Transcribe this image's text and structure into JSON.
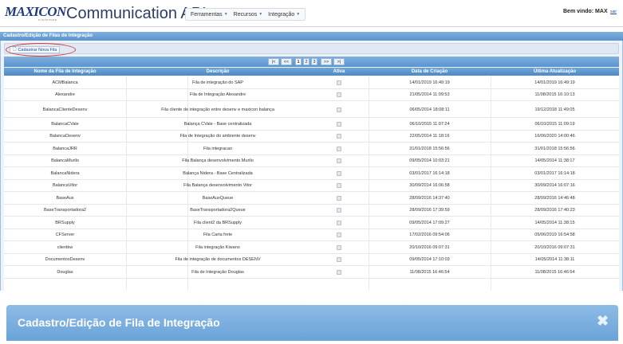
{
  "header": {
    "logo": "MAXICON",
    "logo_sub": "sistemas",
    "app_title": "Communication API",
    "menu": [
      {
        "label": "Ferramentas"
      },
      {
        "label": "Recursos"
      },
      {
        "label": "Integração"
      }
    ],
    "welcome": "Bem vindo: MAX",
    "logout": "sair"
  },
  "window": {
    "title": "Cadastro/Edição de Filas de Integração",
    "add_button": "Cadastrar Nova Fila",
    "pager": {
      "first": "|<",
      "prev": "<<",
      "pages": [
        "1",
        "2",
        "3"
      ],
      "next": ">>",
      "last": ">|",
      "current": "1"
    },
    "columns": [
      "Nome da Fila de Integração",
      "Descrição",
      "Ativa",
      "Data de Criação",
      "Última Atualização"
    ],
    "rows": [
      {
        "name": "ACMBalanca",
        "desc": "Fila de integração do SAP",
        "created": "14/01/2019 16:49:19",
        "updated": "14/01/2019 16:49:19"
      },
      {
        "name": "Alexandre",
        "desc": "Fila de Integração Alexandre",
        "created": "21/05/2014 11:09:53",
        "updated": "11/08/2015 16:10:13"
      },
      {
        "name": "BalancaClienteDesenv",
        "desc": "Fila cliente de integração entre desenv e maxicon balança",
        "created": "06/05/2014 18:08:11",
        "updated": "19/12/2018 11:49:05"
      },
      {
        "name": "BalancaCVale",
        "desc": "Balança CVale - Base centralizada",
        "created": "06/10/2015 11:07:24",
        "updated": "06/10/2015 11:09:19"
      },
      {
        "name": "BalancaDesenv",
        "desc": "Fila de Integração do ambiente desenv",
        "created": "22/05/2014 11:18:16",
        "updated": "16/06/2020 14:00:46"
      },
      {
        "name": "BalancaJRR",
        "desc": "Fila integracao",
        "created": "31/01/2018 15:56:56",
        "updated": "31/01/2018 15:56:56"
      },
      {
        "name": "BalancaMurilo",
        "desc": "Fila Balança desenvolvimento Murilo",
        "created": "09/05/2014 10:03:21",
        "updated": "14/05/2014 11:38:17"
      },
      {
        "name": "BalancaNidera",
        "desc": "Balança Nidera - Base Centralizada",
        "created": "03/01/2017 16:14:18",
        "updated": "03/01/2017 16:14:18"
      },
      {
        "name": "BalancaVitor",
        "desc": "Fila Balança desenvolvimento Vitor",
        "created": "30/09/2014 16:06:58",
        "updated": "30/09/2014 16:07:16"
      },
      {
        "name": "BaseAux",
        "desc": "BaseAuxQueue",
        "created": "28/09/2016 14:37:40",
        "updated": "28/09/2016 14:46:48"
      },
      {
        "name": "BaseTransportadora2",
        "desc": "BaseTransportadora2Queue",
        "created": "28/09/2016 17:39:59",
        "updated": "28/09/2016 17:40:23"
      },
      {
        "name": "BRSupply",
        "desc": "Fila client2 da BRSupply",
        "created": "09/05/2014 17:09:27",
        "updated": "14/05/2014 11:38:15"
      },
      {
        "name": "CFServer",
        "desc": "Fila Carta frete",
        "created": "17/02/2016 09:54:06",
        "updated": "05/06/2019 16:54:58"
      },
      {
        "name": "clientkw",
        "desc": "Fila integração Kiwano",
        "created": "20/10/2016 09:07:31",
        "updated": "20/10/2016 09:07:31"
      },
      {
        "name": "DocumentosDesenv",
        "desc": "Fila de integração de documentos DESENV",
        "created": "09/05/2014 17:10:03",
        "updated": "14/05/2014 11:38:11"
      },
      {
        "name": "Douglas",
        "desc": "Fila de Integração Douglas",
        "created": "11/08/2015 16:46:54",
        "updated": "11/08/2015 16:46:54"
      }
    ]
  },
  "dialog": {
    "title": "Cadastro/Edição de Fila de Integração",
    "close": "✖"
  },
  "colors": {
    "header_blue": "#5a93cf",
    "highlight_red": "#d83a3a",
    "logo_blue": "#1d3a7a"
  }
}
